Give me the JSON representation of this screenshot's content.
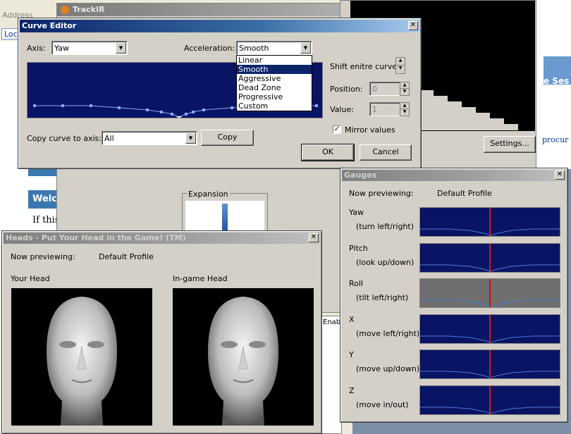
{
  "background_windows": {
    "browser_address_label": "Address",
    "browser_loc_label": "Loc",
    "trackir_title": "TrackIR",
    "welcome_text": "Welc",
    "if_this_text": "If this",
    "right_panel_text": "e Ses",
    "right_link_text": "procur",
    "settings_button": "Settings...",
    "expansion_label": "Expansion",
    "enable_text": "Enab"
  },
  "curve_editor": {
    "title": "Curve Editor",
    "axis_label": "Axis:",
    "axis_value": "Yaw",
    "acceleration_label": "Acceleration:",
    "acceleration_value": "Smooth",
    "acceleration_options": [
      "Linear",
      "Smooth",
      "Aggressive",
      "Dead Zone",
      "Progressive",
      "Custom"
    ],
    "acceleration_selected_index": 1,
    "shift_label": "Shift enitre curve:",
    "position_label": "Position:",
    "position_value": "0",
    "value_label": "Value:",
    "value_value": "1",
    "mirror_label": "Mirror values",
    "mirror_checked": true,
    "copy_label": "Copy curve to axis:",
    "copy_value": "All",
    "copy_button": "Copy",
    "ok_button": "OK",
    "cancel_button": "Cancel"
  },
  "gauges": {
    "title": "Gauges",
    "preview_label": "Now previewing:",
    "preview_value": "Default Profile",
    "items": [
      {
        "name": "Yaw",
        "desc": "(turn left/right)",
        "bg": "#0a1464"
      },
      {
        "name": "Pitch",
        "desc": "(look up/down)",
        "bg": "#0a1464"
      },
      {
        "name": "Roll",
        "desc": "(tilt left/right)",
        "bg": "#6e6e6e"
      },
      {
        "name": "X",
        "desc": "(move left/right)",
        "bg": "#0a1464"
      },
      {
        "name": "Y",
        "desc": "(move up/down)",
        "bg": "#0a1464"
      },
      {
        "name": "Z",
        "desc": "(move in/out)",
        "bg": "#0a1464"
      }
    ]
  },
  "heads": {
    "title": "Heads - Put Your Head in the Game! (TM)",
    "preview_label": "Now previewing:",
    "preview_value": "Default Profile",
    "your_head_label": "Your Head",
    "ingame_head_label": "In-game Head"
  }
}
